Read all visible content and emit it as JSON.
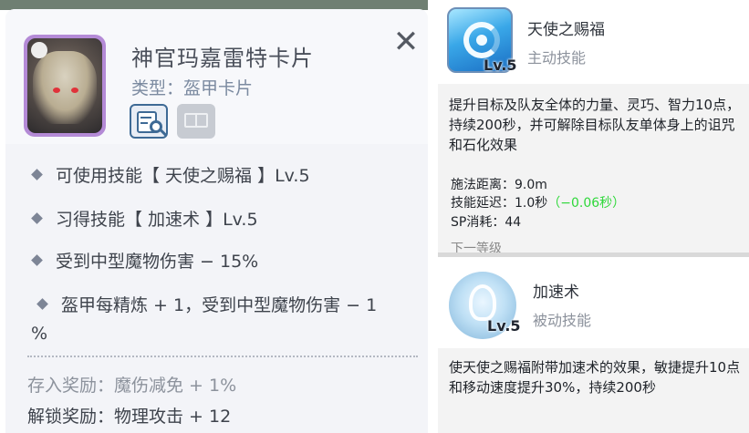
{
  "card": {
    "title": "神官玛嘉雷特卡片",
    "type_label": "类型：",
    "type_value": "盔甲卡片",
    "close_symbol": "✕",
    "properties": [
      "可使用技能【 天使之赐福 】Lv.5",
      "习得技能【 加速术 】Lv.5",
      "受到中型魔物伤害 − 15%"
    ],
    "refine_property_line1": "盔甲每精炼 + 1，受到中型魔物伤害 − 1",
    "refine_property_line2": "%",
    "stored_reward": "存入奖励：魔伤减免 + 1%",
    "unlock_reward": "解锁奖励：物理攻击 + 12"
  },
  "skills": [
    {
      "name": "天使之赐福",
      "kind": "主动技能",
      "level": "Lv.5",
      "description": "提升目标及队友全体的力量、灵巧、智力10点，持续200秒，并可解除目标队友单体身上的诅咒和石化效果",
      "range": "施法距离：9.0m",
      "delay": "技能延迟：1.0秒",
      "delay_bonus": "（−0.06秒）",
      "sp": "SP消耗：44",
      "cut_text": "下一等级"
    },
    {
      "name": "加速术",
      "kind": "被动技能",
      "level": "Lv.5",
      "description": "使天使之赐福附带加速术的效果，敏捷提升10点和移动速度提升30%，持续200秒"
    }
  ],
  "colors": {
    "portrait_frame": "#b48ad6",
    "accent_blue": "#3e6a95",
    "delay_bonus": "#2fd83a"
  },
  "icons": [
    "close-icon",
    "card-detail-icon",
    "book-icon",
    "angel-blessing-skill-icon",
    "increase-agility-skill-icon"
  ]
}
